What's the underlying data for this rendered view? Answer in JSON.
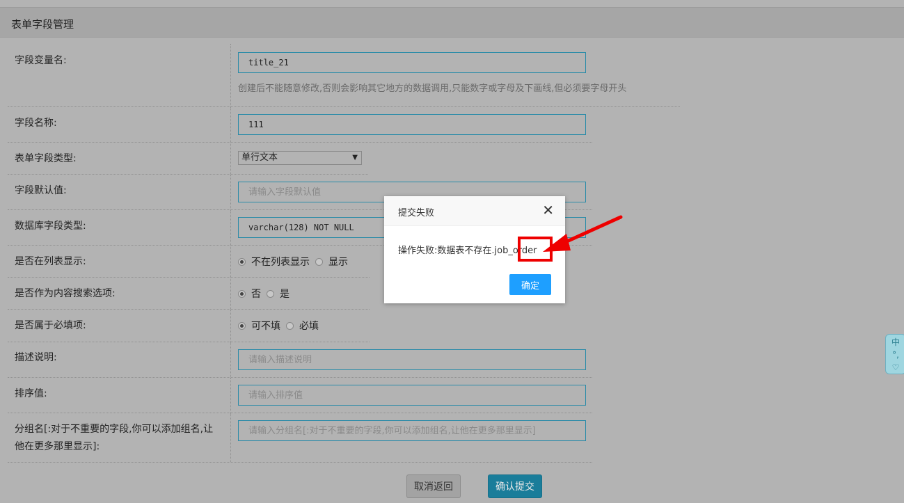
{
  "header": {
    "title": "表单字段管理"
  },
  "fields": {
    "var_name": {
      "label": "字段变量名:",
      "value": "title_21",
      "help": "创建后不能随意修改,否则会影响其它地方的数据调用,只能数字或字母及下画线,但必须要字母开头"
    },
    "name": {
      "label": "字段名称:",
      "value": "111"
    },
    "form_type": {
      "label": "表单字段类型:",
      "selected": "单行文本"
    },
    "default_value": {
      "label": "字段默认值:",
      "placeholder": "请输入字段默认值"
    },
    "db_type": {
      "label": "数据库字段类型:",
      "value": "varchar(128) NOT NULL"
    },
    "list_show": {
      "label": "是否在列表显示:",
      "options": [
        "不在列表显示",
        "显示"
      ],
      "selected": 0
    },
    "search": {
      "label": "是否作为内容搜索选项:",
      "options": [
        "否",
        "是"
      ],
      "selected": 0
    },
    "required": {
      "label": "是否属于必填项:",
      "options": [
        "可不填",
        "必填"
      ],
      "selected": 0
    },
    "description": {
      "label": "描述说明:",
      "placeholder": "请输入描述说明"
    },
    "sort": {
      "label": "排序值:",
      "placeholder": "请输入排序值"
    },
    "group": {
      "label_line1": "分组名[:对于不重要的字段,你可以添加组名,让",
      "label_line2": "他在更多那里显示]:",
      "placeholder": "请输入分组名[:对于不重要的字段,你可以添加组名,让他在更多那里显示]"
    }
  },
  "buttons": {
    "cancel": "取消返回",
    "submit": "确认提交"
  },
  "modal": {
    "title": "提交失败",
    "close": "✕",
    "message": "操作失败:数据表不存在.job_order",
    "ok": "确定"
  },
  "ime": {
    "char": "中",
    "dots": "°,",
    "heart": "♡"
  },
  "colors": {
    "accent": "#1e9fff",
    "submit": "#1a7d9a",
    "highlight": "#ee0000"
  }
}
